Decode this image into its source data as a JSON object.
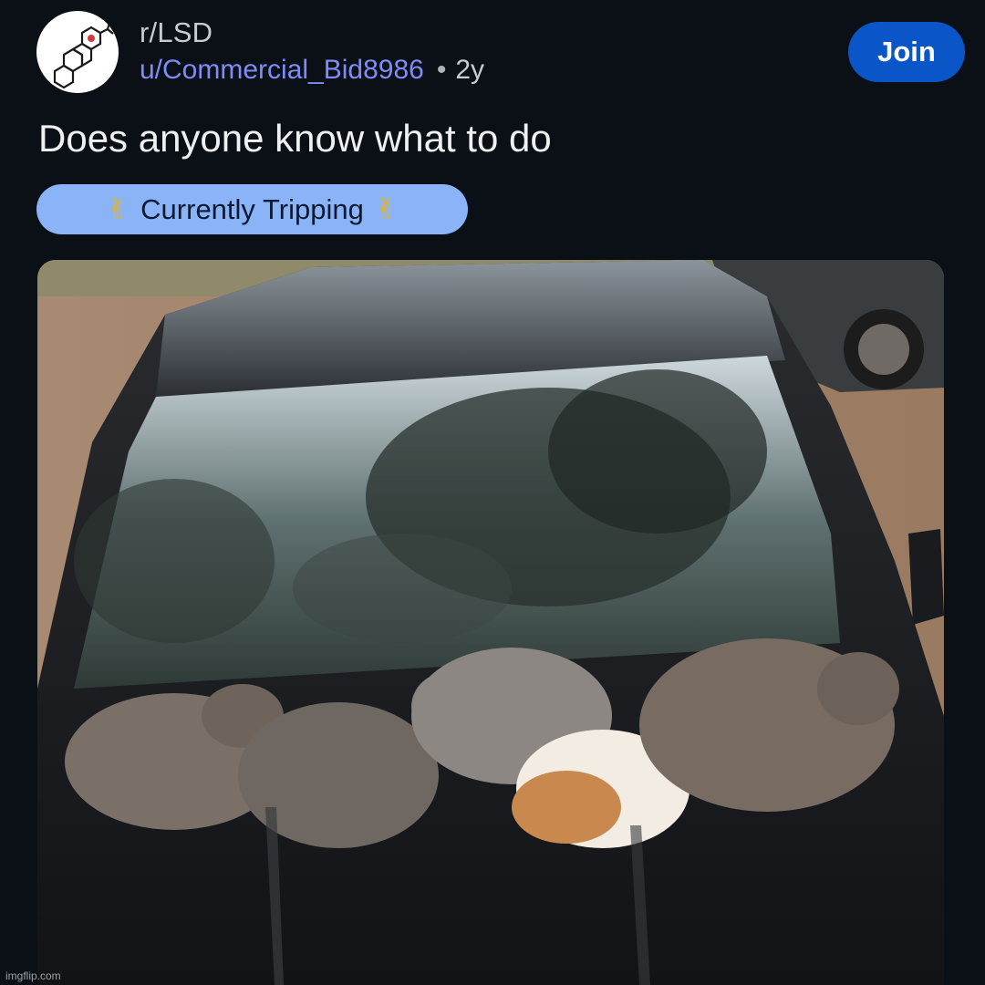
{
  "post": {
    "subreddit": "r/LSD",
    "username": "u/Commercial_Bid8986",
    "separator": "•",
    "age": "2y",
    "title": "Does anyone know what to do",
    "flair": {
      "left_emoji": "✌",
      "label": "Currently Tripping",
      "right_emoji": "✌"
    }
  },
  "actions": {
    "join_label": "Join"
  },
  "watermark": "imgflip.com",
  "colors": {
    "background": "#0b1016",
    "join_button": "#0a55c7",
    "flair_bg": "#8ab3f8",
    "username": "#7f8cf5"
  },
  "icons": {
    "avatar": "molecule-icon",
    "flair_emoji": "victory-hand-icon"
  }
}
